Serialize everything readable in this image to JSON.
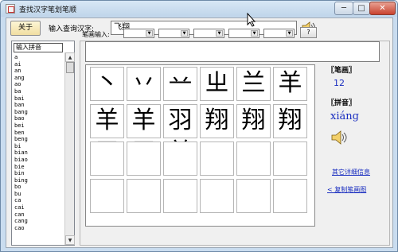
{
  "window": {
    "title": "查找汉字笔划笔顺",
    "min_glyph": "─",
    "max_glyph": "□",
    "close_glyph": "✕"
  },
  "toolbar": {
    "about_label": "关于",
    "input_label": "输入查询汉字:",
    "input_value": "飞翔"
  },
  "pinyin_panel": {
    "header": "输入拼音",
    "items": [
      "a",
      "ai",
      "an",
      "ang",
      "ao",
      "ba",
      "bai",
      "ban",
      "bang",
      "bao",
      "bei",
      "ben",
      "beng",
      "bi",
      "bian",
      "biao",
      "bie",
      "bin",
      "bing",
      "bo",
      "bu",
      "ca",
      "cai",
      "can",
      "cang",
      "cao"
    ],
    "scroll_up": "▲",
    "scroll_down": "▼"
  },
  "stroke_input": {
    "label": "笔画输入:",
    "combo_arrow": "▼",
    "query_label": "?"
  },
  "grid": {
    "cells": [
      "丶",
      "丷",
      "䒑",
      "ㄓ",
      "兰",
      "羊",
      "羊习",
      "羊习",
      "羽羊",
      "翔",
      "翔",
      "翔",
      "",
      "",
      "",
      "",
      "",
      "",
      "",
      "",
      "",
      "",
      "",
      ""
    ]
  },
  "info": {
    "strokes_title": "〖笔画〗",
    "strokes_value": "12",
    "pinyin_title": "〖拼音〗",
    "pinyin_value": "xiáng",
    "detail_link": "其它详细信息",
    "copy_link": "< 复制笔画图"
  },
  "colors": {
    "link": "#1a2ec0",
    "title_bar": "#c9dcef"
  }
}
